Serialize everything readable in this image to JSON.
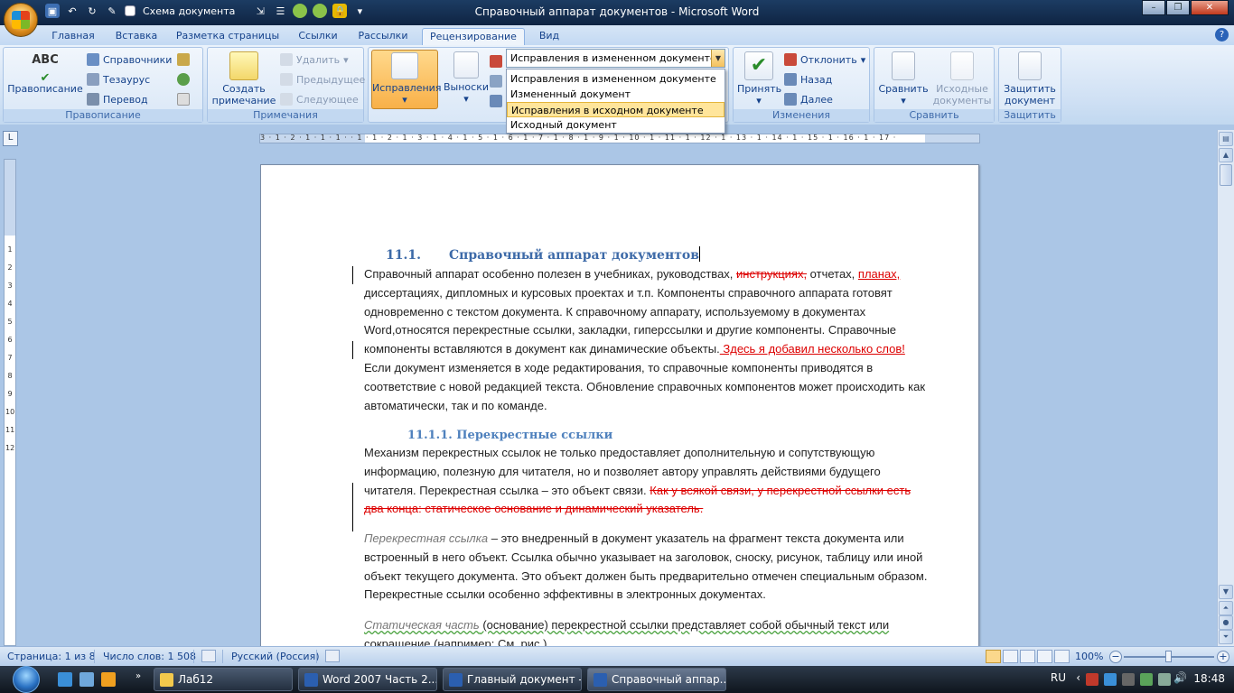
{
  "window": {
    "title": "Справочный аппарат документов - Microsoft Word",
    "qat_label": "Схема документа",
    "buttons": [
      "–",
      "❐",
      "✕"
    ]
  },
  "tabs": [
    "Главная",
    "Вставка",
    "Разметка страницы",
    "Ссылки",
    "Рассылки",
    "Рецензирование",
    "Вид"
  ],
  "active_tab": "Рецензирование",
  "ribbon": {
    "proofing": {
      "label": "Правописание",
      "spelling": "Правописание",
      "spelling_icon_text": "ABC",
      "research": "Справочники",
      "thesaurus": "Тезаурус",
      "translate": "Перевод"
    },
    "comments": {
      "label": "Примечания",
      "new_comment_line1": "Создать",
      "new_comment_line2": "примечание",
      "delete": "Удалить",
      "previous": "Предыдущее",
      "next": "Следующее"
    },
    "tracking": {
      "track_changes": "Исправления",
      "balloons": "Выноски",
      "combo_value": "Исправления в измененном документе",
      "combo_options": [
        "Исправления в измененном документе",
        "Измененный документ",
        "Исправления в исходном документе",
        "Исходный документ"
      ],
      "combo_highlighted": 2
    },
    "changes": {
      "label": "Изменения",
      "accept": "Принять",
      "reject": "Отклонить",
      "previous": "Назад",
      "next": "Далее"
    },
    "compare": {
      "label": "Сравнить",
      "compare": "Сравнить",
      "source_line1": "Исходные",
      "source_line2": "документы"
    },
    "protect": {
      "label": "Защитить",
      "protect_line1": "Защитить",
      "protect_line2": "документ"
    }
  },
  "ruler": {
    "numbers": "3 · 1 · 2 · 1 · 1 · 1 ·   · 1 · 1 · 2 · 1 · 3 · 1 · 4 · 1 · 5 · 1 · 6 · 1 · 7 · 1 · 8 · 1 · 9 · 1 · 10 · 1 · 11 · 1 · 12 · 1 · 13 · 1 · 14 · 1 · 15 · 1 · 16 · 1 · 17 ·",
    "vertical_numbers": [
      "1",
      "2",
      "3",
      "4",
      "5",
      "6",
      "7",
      "8",
      "9",
      "10",
      "11",
      "12"
    ]
  },
  "document": {
    "heading1_num": "11.1.",
    "heading1_text": "Справочный аппарат  документов",
    "p1": {
      "a": "Справочный аппарат особенно полезен в учебниках, руководствах, ",
      "del1": "инструкциях,",
      "b": " отчетах, ",
      "ins1": "планах,",
      "c": " диссертациях, дипломных и курсовых проектах и т.п. Компоненты справочного аппарата готовят одновременно с текстом документа. К справочному аппарату, используемому в документах Word,относятся перекрестные ссылки, закладки, гиперссылки и другие компоненты. Справочные компоненты вставляются в документ как динамические объекты.",
      "ins2": " Здесь я добавил несколько слов!",
      "d": " Если документ изменяется в ходе редактирования, то справочные компоненты приводятся в соответствие с новой редакцией текста. Обновление справочных компонентов может происходить как автоматически, так и по команде."
    },
    "heading2": "11.1.1. Перекрестные ссылки",
    "p2": {
      "a": "Механизм перекрестных ссылок не только предоставляет дополнительную  и сопутствующую информацию, полезную для читателя, но и позволяет автору управлять действиями будущего читателя. Перекрестная ссылка – это объект связи. ",
      "del": "Как у всякой связи, у перекрестной ссылки есть два конца: статическое основание и динамический указатель."
    },
    "p3": {
      "ital": "Перекрестная ссылка",
      "rest": " – это внедренный в документ указатель на фрагмент текста документа или встроенный в него объект. Ссылка обычно указывает на заголовок, сноску, рисунок, таблицу или иной объект текущего документа. Это объект должен быть предварительно отмечен специальным образом. Перекрестные ссылки особенно эффективны в электронных документах."
    },
    "p4": {
      "ital": "Статическая часть",
      "rest": " (основание) перекрестной ссылки представляет собой обычный текст или сокращение (например: См. рис.)"
    }
  },
  "status": {
    "page": "Страница: 1 из 8",
    "words": "Число слов: 1 508",
    "language": "Русский (Россия)",
    "zoom": "100%"
  },
  "taskbar": {
    "items": [
      "Лаб12",
      "Word 2007 Часть 2....",
      "Главный документ -...",
      "Справочный аппар..."
    ],
    "active_index": 3,
    "lang": "RU",
    "time": "18:48"
  },
  "colors": {
    "accent": "#15428b",
    "revision": "#dd0000",
    "heading": "#4f81bd"
  }
}
